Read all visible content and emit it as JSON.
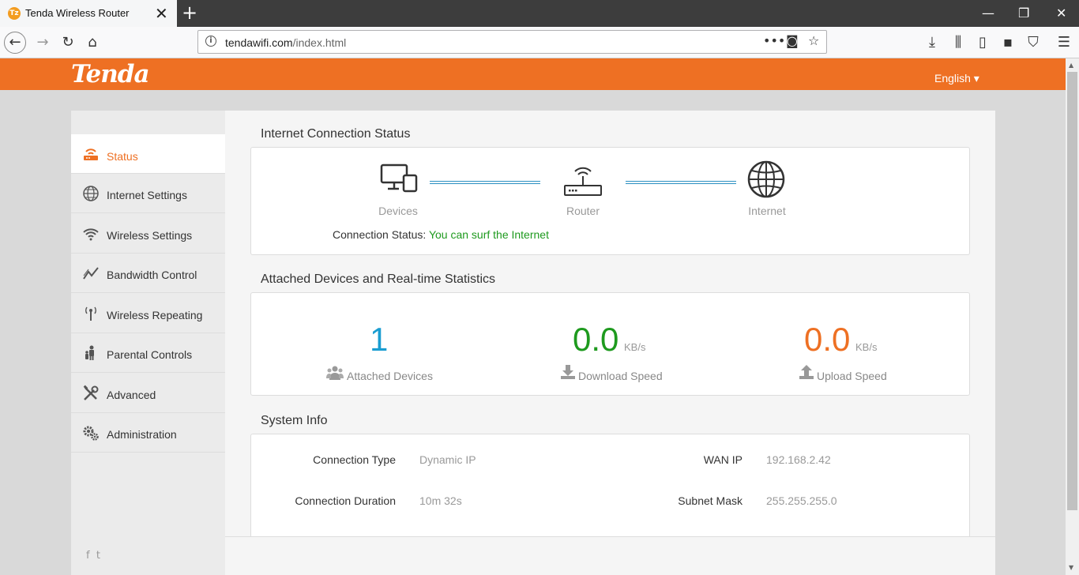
{
  "browser": {
    "tab_title": "Tenda Wireless Router",
    "tab_close": "✕",
    "new_tab": "+",
    "url_host": "tendawifi.com",
    "url_path": "/index.html",
    "window_controls": [
      "—",
      "❐",
      "✕"
    ]
  },
  "header": {
    "logo": "Tenda",
    "language": "English ▾",
    "accent_color": "#ee7023"
  },
  "sidebar": {
    "items": [
      {
        "label": "Status",
        "icon": "router-icon",
        "active": true
      },
      {
        "label": "Internet Settings",
        "icon": "globe-icon"
      },
      {
        "label": "Wireless Settings",
        "icon": "wifi-icon"
      },
      {
        "label": "Bandwidth Control",
        "icon": "chart-line-icon"
      },
      {
        "label": "Wireless Repeating",
        "icon": "antenna-icon"
      },
      {
        "label": "Parental Controls",
        "icon": "family-icon"
      },
      {
        "label": "Advanced",
        "icon": "tools-icon"
      },
      {
        "label": "Administration",
        "icon": "gears-icon"
      }
    ],
    "social": [
      "f",
      "t"
    ]
  },
  "connection": {
    "title": "Internet Connection Status",
    "devices_label": "Devices",
    "router_label": "Router",
    "internet_label": "Internet",
    "status_key": "Connection Status:",
    "status_value": "You can surf the Internet"
  },
  "stats": {
    "title": "Attached Devices and Real-time Statistics",
    "attached_count": "1",
    "attached_label": "Attached Devices",
    "download_value": "0.0",
    "download_unit": "KB/s",
    "download_label": "Download Speed",
    "upload_value": "0.0",
    "upload_unit": "KB/s",
    "upload_label": "Upload Speed",
    "colors": {
      "attached": "#1a9dd1",
      "download": "#1e9a1e",
      "upload": "#ee7023"
    }
  },
  "system": {
    "title": "System Info",
    "connection_type_key": "Connection Type",
    "connection_type_value": "Dynamic IP",
    "wan_ip_key": "WAN IP",
    "wan_ip_value": "192.168.2.42",
    "duration_key": "Connection Duration",
    "duration_value": "10m 32s",
    "subnet_key": "Subnet Mask",
    "subnet_value": "255.255.255.0"
  }
}
